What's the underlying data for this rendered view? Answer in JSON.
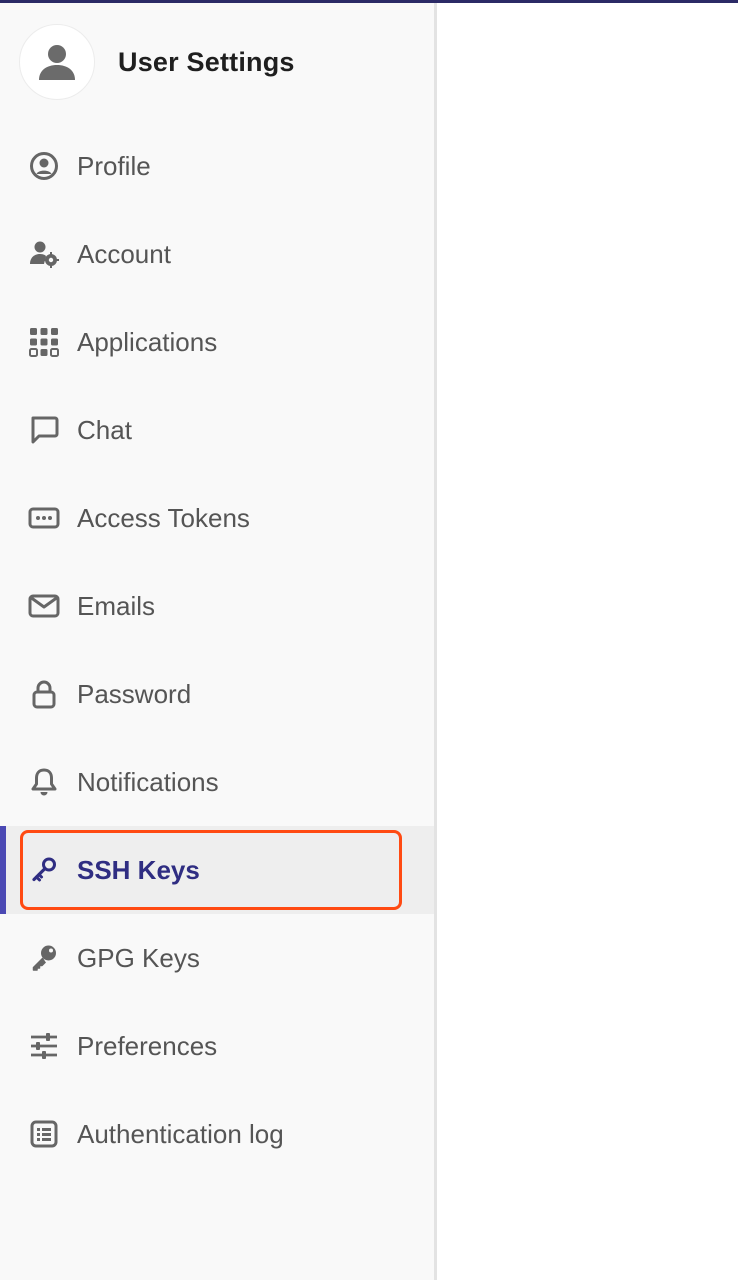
{
  "header": {
    "title": "User Settings",
    "avatar_icon": "user-avatar-icon"
  },
  "nav": {
    "items": [
      {
        "label": "Profile",
        "icon": "profile-circle-icon"
      },
      {
        "label": "Account",
        "icon": "user-gear-icon"
      },
      {
        "label": "Applications",
        "icon": "app-grid-icon"
      },
      {
        "label": "Chat",
        "icon": "chat-bubble-icon"
      },
      {
        "label": "Access Tokens",
        "icon": "token-icon"
      },
      {
        "label": "Emails",
        "icon": "envelope-icon"
      },
      {
        "label": "Password",
        "icon": "lock-icon"
      },
      {
        "label": "Notifications",
        "icon": "bell-icon"
      },
      {
        "label": "SSH Keys",
        "icon": "ssh-key-icon"
      },
      {
        "label": "GPG Keys",
        "icon": "gpg-key-icon"
      },
      {
        "label": "Preferences",
        "icon": "sliders-icon"
      },
      {
        "label": "Authentication log",
        "icon": "log-list-icon"
      }
    ],
    "active": "SSH Keys"
  },
  "colors": {
    "accent": "#4b49b4",
    "active_text": "#2f2d82",
    "highlight_border": "#ff4a12",
    "sidebar_bg": "#f9f9f9",
    "icon_gray": "#666666"
  }
}
